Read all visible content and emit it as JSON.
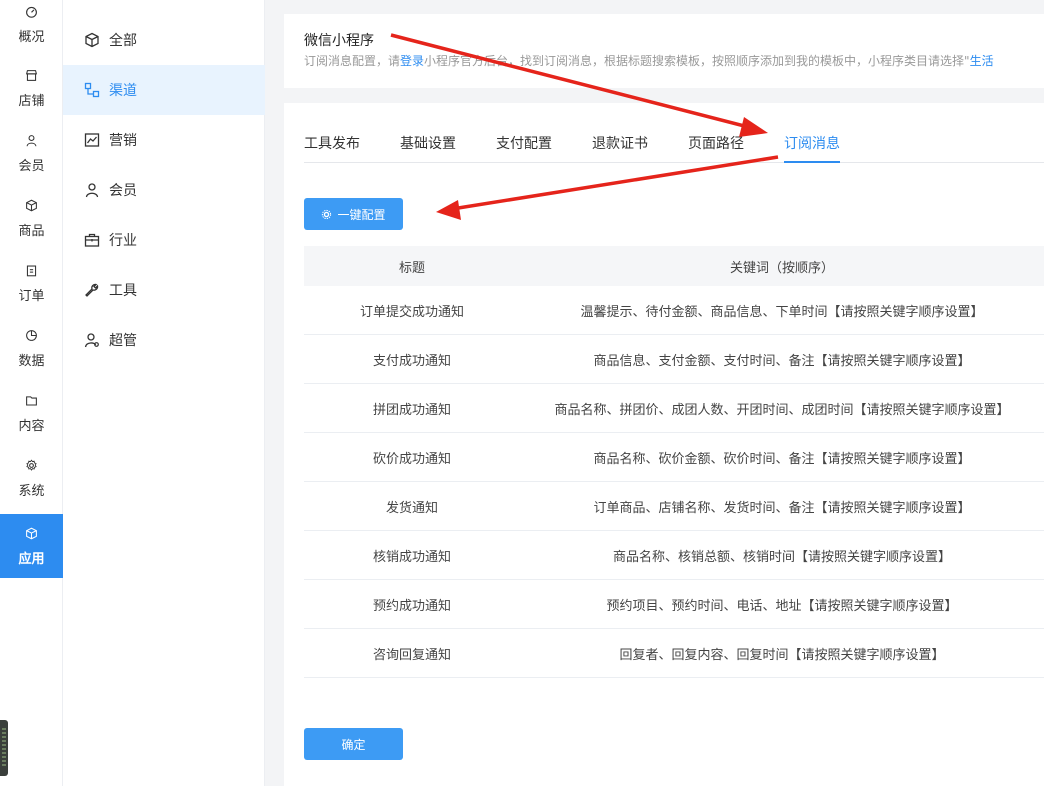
{
  "rail": {
    "items": [
      {
        "label": "概况",
        "icon": "dashboard-icon"
      },
      {
        "label": "店铺",
        "icon": "store-icon"
      },
      {
        "label": "会员",
        "icon": "user-icon"
      },
      {
        "label": "商品",
        "icon": "box-icon"
      },
      {
        "label": "订单",
        "icon": "clipboard-icon"
      },
      {
        "label": "数据",
        "icon": "pie-chart-icon"
      },
      {
        "label": "内容",
        "icon": "folder-icon"
      },
      {
        "label": "系统",
        "icon": "gear-icon"
      },
      {
        "label": "应用",
        "icon": "cube-icon"
      }
    ],
    "active_index": 8
  },
  "sidebar": {
    "items": [
      {
        "label": "全部",
        "icon": "cube-icon"
      },
      {
        "label": "渠道",
        "icon": "channels-icon"
      },
      {
        "label": "营销",
        "icon": "line-chart-icon"
      },
      {
        "label": "会员",
        "icon": "user-icon"
      },
      {
        "label": "行业",
        "icon": "briefcase-icon"
      },
      {
        "label": "工具",
        "icon": "wrench-icon"
      },
      {
        "label": "超管",
        "icon": "admin-icon"
      }
    ],
    "active_index": 1
  },
  "header": {
    "title": "微信小程序",
    "desc_before": "订阅消息配置，请",
    "desc_link": "登录",
    "desc_after": "小程序官方后台，找到订阅消息，根据标题搜索模板，按照顺序添加到我的模板中，小程序类目请选择\"",
    "desc_link2": "生活"
  },
  "tabs": [
    {
      "label": "工具发布"
    },
    {
      "label": "基础设置"
    },
    {
      "label": "支付配置"
    },
    {
      "label": "退款证书"
    },
    {
      "label": "页面路径"
    },
    {
      "label": "订阅消息"
    }
  ],
  "active_tab": 5,
  "buttons": {
    "config_label": "一键配置",
    "ok_label": "确定"
  },
  "table": {
    "headers": [
      "标题",
      "关键词（按顺序）"
    ],
    "rows": [
      [
        "订单提交成功通知",
        "温馨提示、待付金额、商品信息、下单时间【请按照关键字顺序设置】"
      ],
      [
        "支付成功通知",
        "商品信息、支付金额、支付时间、备注【请按照关键字顺序设置】"
      ],
      [
        "拼团成功通知",
        "商品名称、拼团价、成团人数、开团时间、成团时间【请按照关键字顺序设置】"
      ],
      [
        "砍价成功通知",
        "商品名称、砍价金额、砍价时间、备注【请按照关键字顺序设置】"
      ],
      [
        "发货通知",
        "订单商品、店铺名称、发货时间、备注【请按照关键字顺序设置】"
      ],
      [
        "核销成功通知",
        "商品名称、核销总额、核销时间【请按照关键字顺序设置】"
      ],
      [
        "预约成功通知",
        "预约项目、预约时间、电话、地址【请按照关键字顺序设置】"
      ],
      [
        "咨询回复通知",
        "回复者、回复内容、回复时间【请按照关键字顺序设置】"
      ]
    ]
  },
  "colors": {
    "accent": "#2d8cf0",
    "arrow": "#e5241b"
  }
}
